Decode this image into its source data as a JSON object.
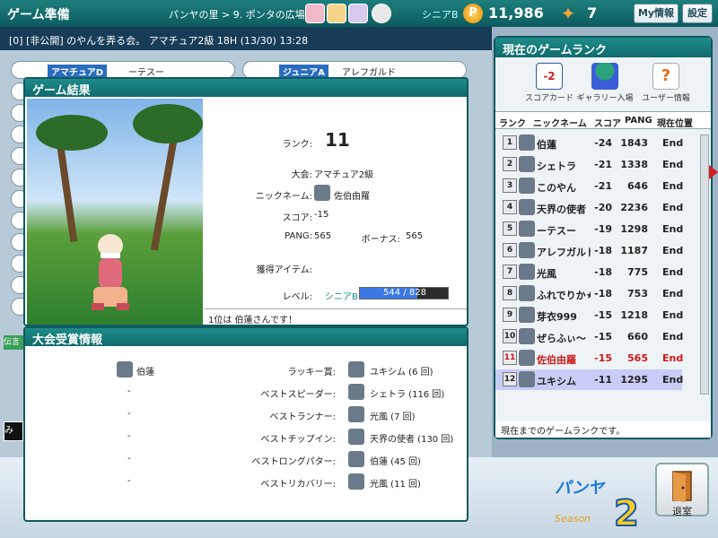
{
  "topbar": {
    "title": "ゲーム準備",
    "breadcrumb": "パンヤの里 > 9. ポンタの広場",
    "rank_label": "シニアB",
    "pang_icon": "P",
    "pang": "11,986",
    "cookie": "7",
    "my_info_label": "My情報",
    "settings_label": "設定"
  },
  "room": {
    "info": "[0] [非公開] のやんを弄る会。 アマチュア2級 18H (13/30) 13:28"
  },
  "lobby": {
    "slot1_rank": "アマチュアD",
    "slot1_name": "ーテスー",
    "slot2_rank": "ジュニアA",
    "slot2_name": "アレフガルド",
    "chat_tab": "伝言",
    "chat_input": "み"
  },
  "result": {
    "title": "ゲーム結果",
    "rank_label": "ランク:",
    "rank_value": "11",
    "tournament_label": "大会:",
    "tournament_value": "アマチュア2級",
    "nickname_label": "ニックネーム:",
    "nickname_value": "佐伯由羅",
    "score_label": "スコア:",
    "score_value": "-15",
    "pang_label": "PANG:",
    "pang_value": "565",
    "bonus_label": "ボーナス:",
    "bonus_value": "565",
    "items_label": "獲得アイテム:",
    "level_label": "レベル:",
    "level_rank": "シニアB",
    "level_progress": "544 / 828",
    "level_fraction": 0.657,
    "message": "1位は 伯蓮さんです！"
  },
  "awards": {
    "title": "大会受賞情報",
    "rows": [
      {
        "left": "伯蓮",
        "label": "ラッキー賞:",
        "winner": "ユキシム (6 回)"
      },
      {
        "left": "-",
        "label": "ベストスピーダー:",
        "winner": "シェトラ (116 回)"
      },
      {
        "left": "-",
        "label": "ベストランナー:",
        "winner": "光風 (7 回)"
      },
      {
        "left": "-",
        "label": "ベストチップイン:",
        "winner": "天界の使者 (130 回)"
      },
      {
        "left": "-",
        "label": "ベストロングパター:",
        "winner": "伯蓮 (45 回)"
      },
      {
        "left": "-",
        "label": "ベストリカバリー:",
        "winner": "光風 (11 回)"
      }
    ]
  },
  "ranking": {
    "title": "現在のゲームランク",
    "scorecard_label": "スコアカード",
    "gallery_label": "ギャラリー入場",
    "userinfo_label": "ユーザー情報",
    "scorecard_icon_text": "-2",
    "col_rank": "ランク",
    "col_name": "ニックネーム",
    "col_score": "スコア",
    "col_pang": "PANG",
    "col_pos": "現在位置",
    "rows": [
      {
        "rank": "1",
        "name": "伯蓮",
        "score": "-24",
        "pang": "1843",
        "pos": "End"
      },
      {
        "rank": "2",
        "name": "シェトラ",
        "score": "-21",
        "pang": "1338",
        "pos": "End"
      },
      {
        "rank": "3",
        "name": "このやん",
        "score": "-21",
        "pang": "646",
        "pos": "End"
      },
      {
        "rank": "4",
        "name": "天界の使者",
        "score": "-20",
        "pang": "2236",
        "pos": "End"
      },
      {
        "rank": "5",
        "name": "ーテスー",
        "score": "-19",
        "pang": "1298",
        "pos": "End"
      },
      {
        "rank": "6",
        "name": "アレフガルド",
        "score": "-18",
        "pang": "1187",
        "pos": "End"
      },
      {
        "rank": "7",
        "name": "光風",
        "score": "-18",
        "pang": "775",
        "pos": "End"
      },
      {
        "rank": "8",
        "name": "ふれでりか★",
        "score": "-18",
        "pang": "753",
        "pos": "End"
      },
      {
        "rank": "9",
        "name": "芽衣999",
        "score": "-15",
        "pang": "1218",
        "pos": "End"
      },
      {
        "rank": "10",
        "name": "ぜらふぃ〜",
        "score": "-15",
        "pang": "660",
        "pos": "End"
      },
      {
        "rank": "11",
        "name": "佐伯由羅",
        "score": "-15",
        "pang": "565",
        "pos": "End"
      },
      {
        "rank": "12",
        "name": "ユキシム",
        "score": "-11",
        "pang": "1295",
        "pos": "End"
      }
    ],
    "footer": "現在までのゲームランクです。"
  },
  "bottom": {
    "exit_label": "退室",
    "logo_season": "Season",
    "logo_number": "2"
  },
  "colors": {
    "highlight_row": "#c8ccf6",
    "self_row_text": "#d01818",
    "panel_title": "#0f6a6e"
  }
}
